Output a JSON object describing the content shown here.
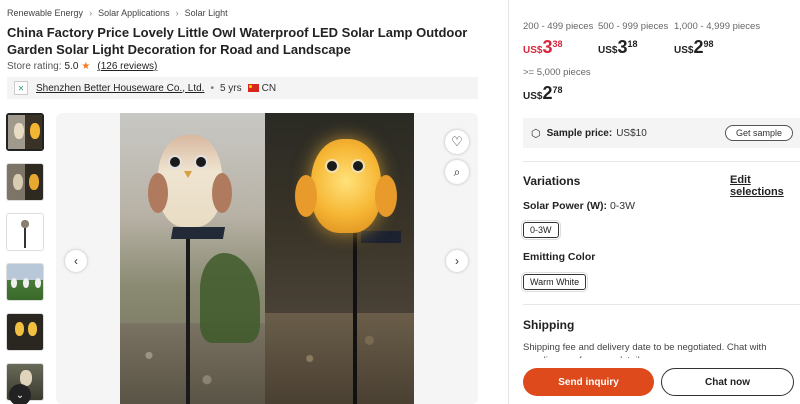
{
  "breadcrumb": [
    "Renewable Energy",
    "Solar Applications",
    "Solar Light"
  ],
  "breadcrumb_sep": "›",
  "product": {
    "title": "China Factory Price Lovely Little Owl Waterproof LED Solar Lamp Outdoor Garden Solar Light Decoration for Road and Landscape"
  },
  "rating": {
    "label": "Store rating:",
    "score": "5.0",
    "star": "★",
    "reviews": "(126 reviews)"
  },
  "supplier": {
    "logo": "✕",
    "name": "Shenzhen Better Houseware Co., Ltd.",
    "dot": "•",
    "years": "5 yrs",
    "country": "CN"
  },
  "gallery": {
    "prev_icon": "‹",
    "next_icon": "›",
    "down_icon": "⌄",
    "favorite_icon": "♡",
    "search_icon": "⌕"
  },
  "pricing": {
    "tiers": [
      {
        "range": "200 - 499 pieces",
        "currency": "US$",
        "whole": "3",
        "cents": "38",
        "accent": true
      },
      {
        "range": "500 - 999 pieces",
        "currency": "US$",
        "whole": "3",
        "cents": "18",
        "accent": false
      },
      {
        "range": "1,000 - 4,999 pieces",
        "currency": "US$",
        "whole": "2",
        "cents": "98",
        "accent": false
      },
      {
        "range": ">= 5,000 pieces",
        "currency": "US$",
        "whole": "2",
        "cents": "78",
        "accent": false
      }
    ]
  },
  "sample": {
    "icon": "⬡",
    "label": "Sample price:",
    "value": "US$10",
    "button": "Get sample"
  },
  "variations": {
    "title": "Variations",
    "edit": "Edit selections",
    "power_label": "Solar Power (W):",
    "power_value": "0-3W",
    "power_chip": "0-3W",
    "color_label": "Emitting Color",
    "color_chip": "Warm White"
  },
  "shipping": {
    "title": "Shipping",
    "text": "Shipping fee and delivery date to be negotiated. Chat with supplier now for more details."
  },
  "actions": {
    "inquiry": "Send inquiry",
    "chat": "Chat now"
  },
  "colors": {
    "accent": "#de4a1c",
    "price_red": "#d7263d",
    "star": "#f07b24"
  }
}
